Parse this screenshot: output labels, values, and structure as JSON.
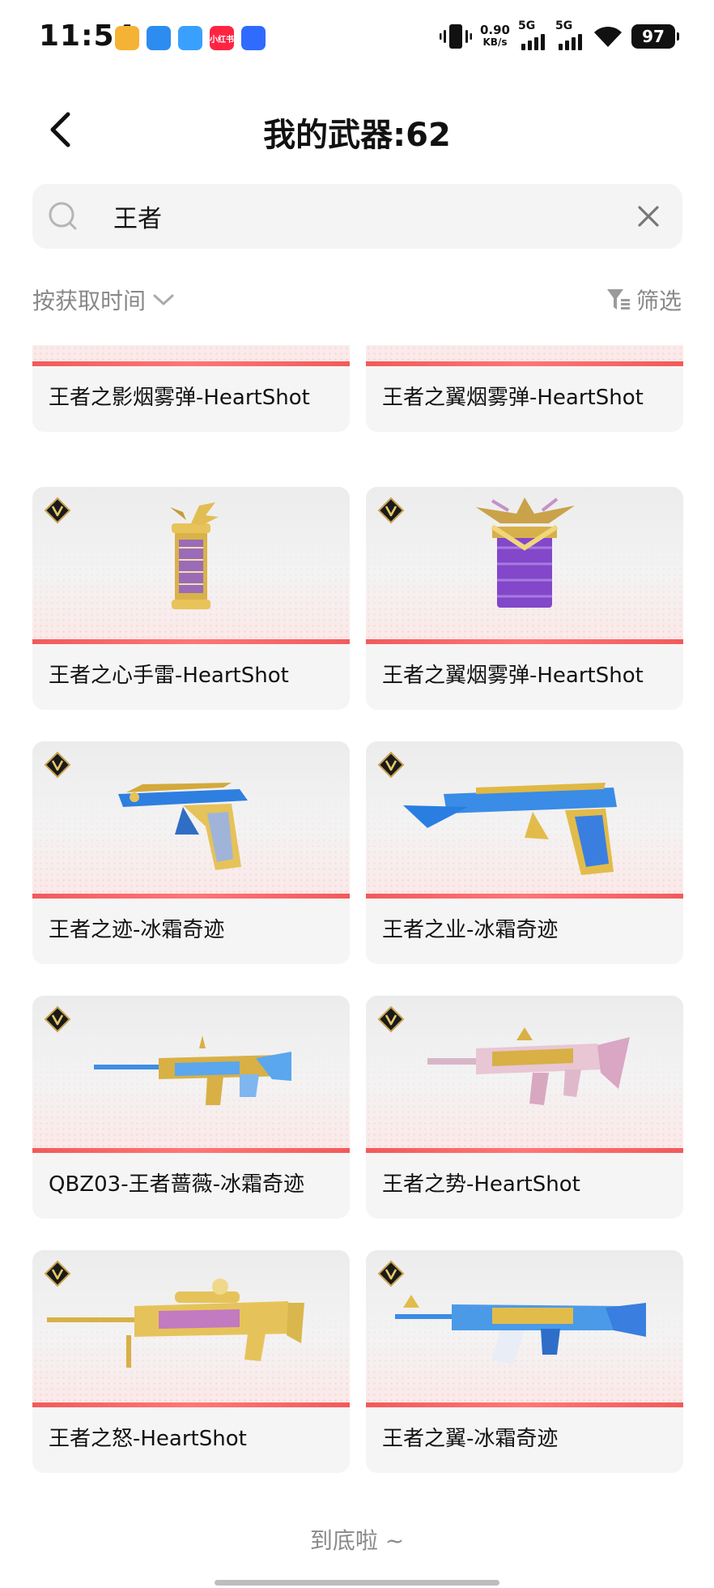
{
  "status_bar": {
    "time": "11:54",
    "net_speed_value": "0.90",
    "net_speed_unit": "KB/s",
    "sim1_label": "5G",
    "sim2_label": "5G",
    "battery": "97",
    "app_icons": [
      {
        "name": "target-app-icon",
        "color": "#f5b335",
        "text": ""
      },
      {
        "name": "feather-app-icon",
        "color": "#2d8cf0",
        "text": ""
      },
      {
        "name": "cloud-app-icon",
        "color": "#3aa0ff",
        "text": ""
      },
      {
        "name": "xiaohongshu-app-icon",
        "color": "#ff2442",
        "text": "小红书"
      },
      {
        "name": "blue-app-icon",
        "color": "#2f6bff",
        "text": ""
      }
    ]
  },
  "header": {
    "title": "我的武器:62"
  },
  "search": {
    "value": "王者",
    "placeholder": ""
  },
  "sort": {
    "label": "按获取时间"
  },
  "filter": {
    "label": "筛选"
  },
  "cards": [
    {
      "name": "王者之影烟雾弹-HeartShot",
      "weapon": "grenade-gold"
    },
    {
      "name": "王者之翼烟雾弹-HeartShot",
      "weapon": "smoke-purple"
    },
    {
      "name": "王者之心手雷-HeartShot",
      "weapon": "grenade-gold"
    },
    {
      "name": "王者之翼烟雾弹-HeartShot",
      "weapon": "smoke-purple"
    },
    {
      "name": "王者之迹-冰霜奇迹",
      "weapon": "pistol-blue"
    },
    {
      "name": "王者之业-冰霜奇迹",
      "weapon": "deagle-blue"
    },
    {
      "name": "QBZ03-王者蔷薇-冰霜奇迹",
      "weapon": "rifle-blue"
    },
    {
      "name": "王者之势-HeartShot",
      "weapon": "smg-pink"
    },
    {
      "name": "王者之怒-HeartShot",
      "weapon": "sniper-gold"
    },
    {
      "name": "王者之翼-冰霜奇迹",
      "weapon": "ak-blue"
    }
  ],
  "footer": {
    "end_text": "到底啦 ~"
  },
  "colors": {
    "accent_red": "#f25a5a",
    "card_bg": "#f5f5f5",
    "muted_text": "#888888"
  }
}
